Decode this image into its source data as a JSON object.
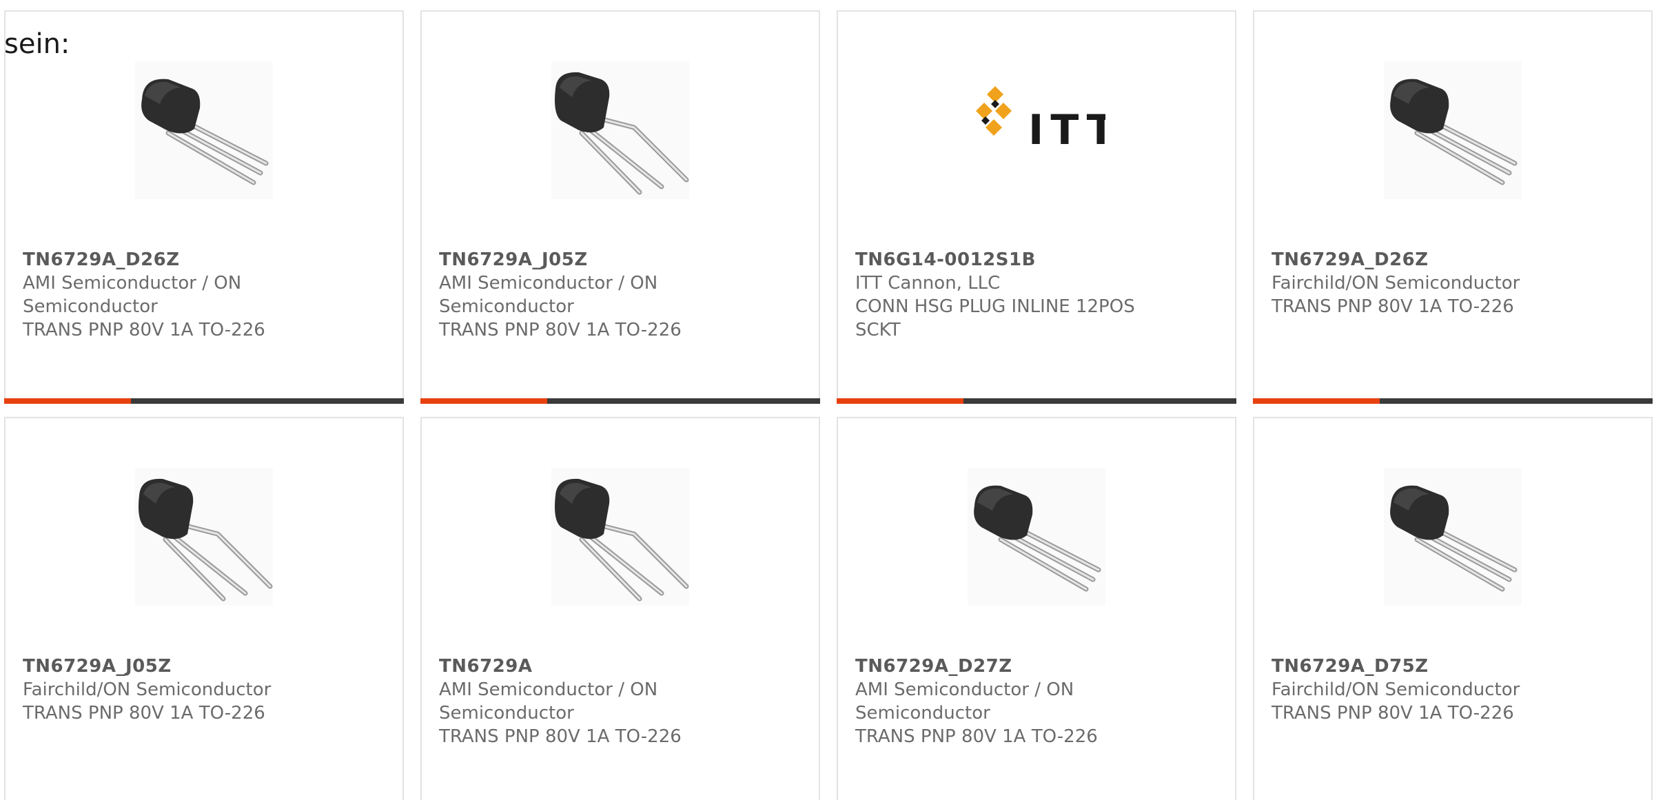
{
  "intro_text": "sein:",
  "colors": {
    "accent": "#e8410f",
    "bar": "#3a3a3a",
    "text": "#6b6b6b",
    "card_border": "#e3e3e3"
  },
  "products": [
    {
      "part_no": "TN6729A_D26Z",
      "manufacturer": "AMI Semiconductor / ON\nSemiconductor",
      "description": "TRANS PNP 80V 1A TO-226",
      "image": "to92-transistor-straight-leads"
    },
    {
      "part_no": "TN6729A_J05Z",
      "manufacturer": "AMI Semiconductor / ON\nSemiconductor",
      "description": "TRANS PNP 80V 1A TO-226",
      "image": "to92-transistor-bent-leads"
    },
    {
      "part_no": "TN6G14-0012S1B",
      "manufacturer": "ITT Cannon, LLC",
      "description": "CONN HSG PLUG INLINE 12POS\nSCKT",
      "image": "itt-logo",
      "logo_text": "ITT"
    },
    {
      "part_no": "TN6729A_D26Z",
      "manufacturer": "Fairchild/ON Semiconductor",
      "description": "TRANS PNP 80V 1A TO-226",
      "image": "to92-transistor-straight-leads"
    },
    {
      "part_no": "TN6729A_J05Z",
      "manufacturer": "Fairchild/ON Semiconductor",
      "description": "TRANS PNP 80V 1A TO-226",
      "image": "to92-transistor-bent-leads"
    },
    {
      "part_no": "TN6729A",
      "manufacturer": "AMI Semiconductor / ON\nSemiconductor",
      "description": "TRANS PNP 80V 1A TO-226",
      "image": "to92-transistor-bent-leads"
    },
    {
      "part_no": "TN6729A_D27Z",
      "manufacturer": "AMI Semiconductor / ON\nSemiconductor",
      "description": "TRANS PNP 80V 1A TO-226",
      "image": "to92-transistor-straight-leads"
    },
    {
      "part_no": "TN6729A_D75Z",
      "manufacturer": "Fairchild/ON Semiconductor",
      "description": "TRANS PNP 80V 1A TO-226",
      "image": "to92-transistor-straight-leads"
    }
  ]
}
